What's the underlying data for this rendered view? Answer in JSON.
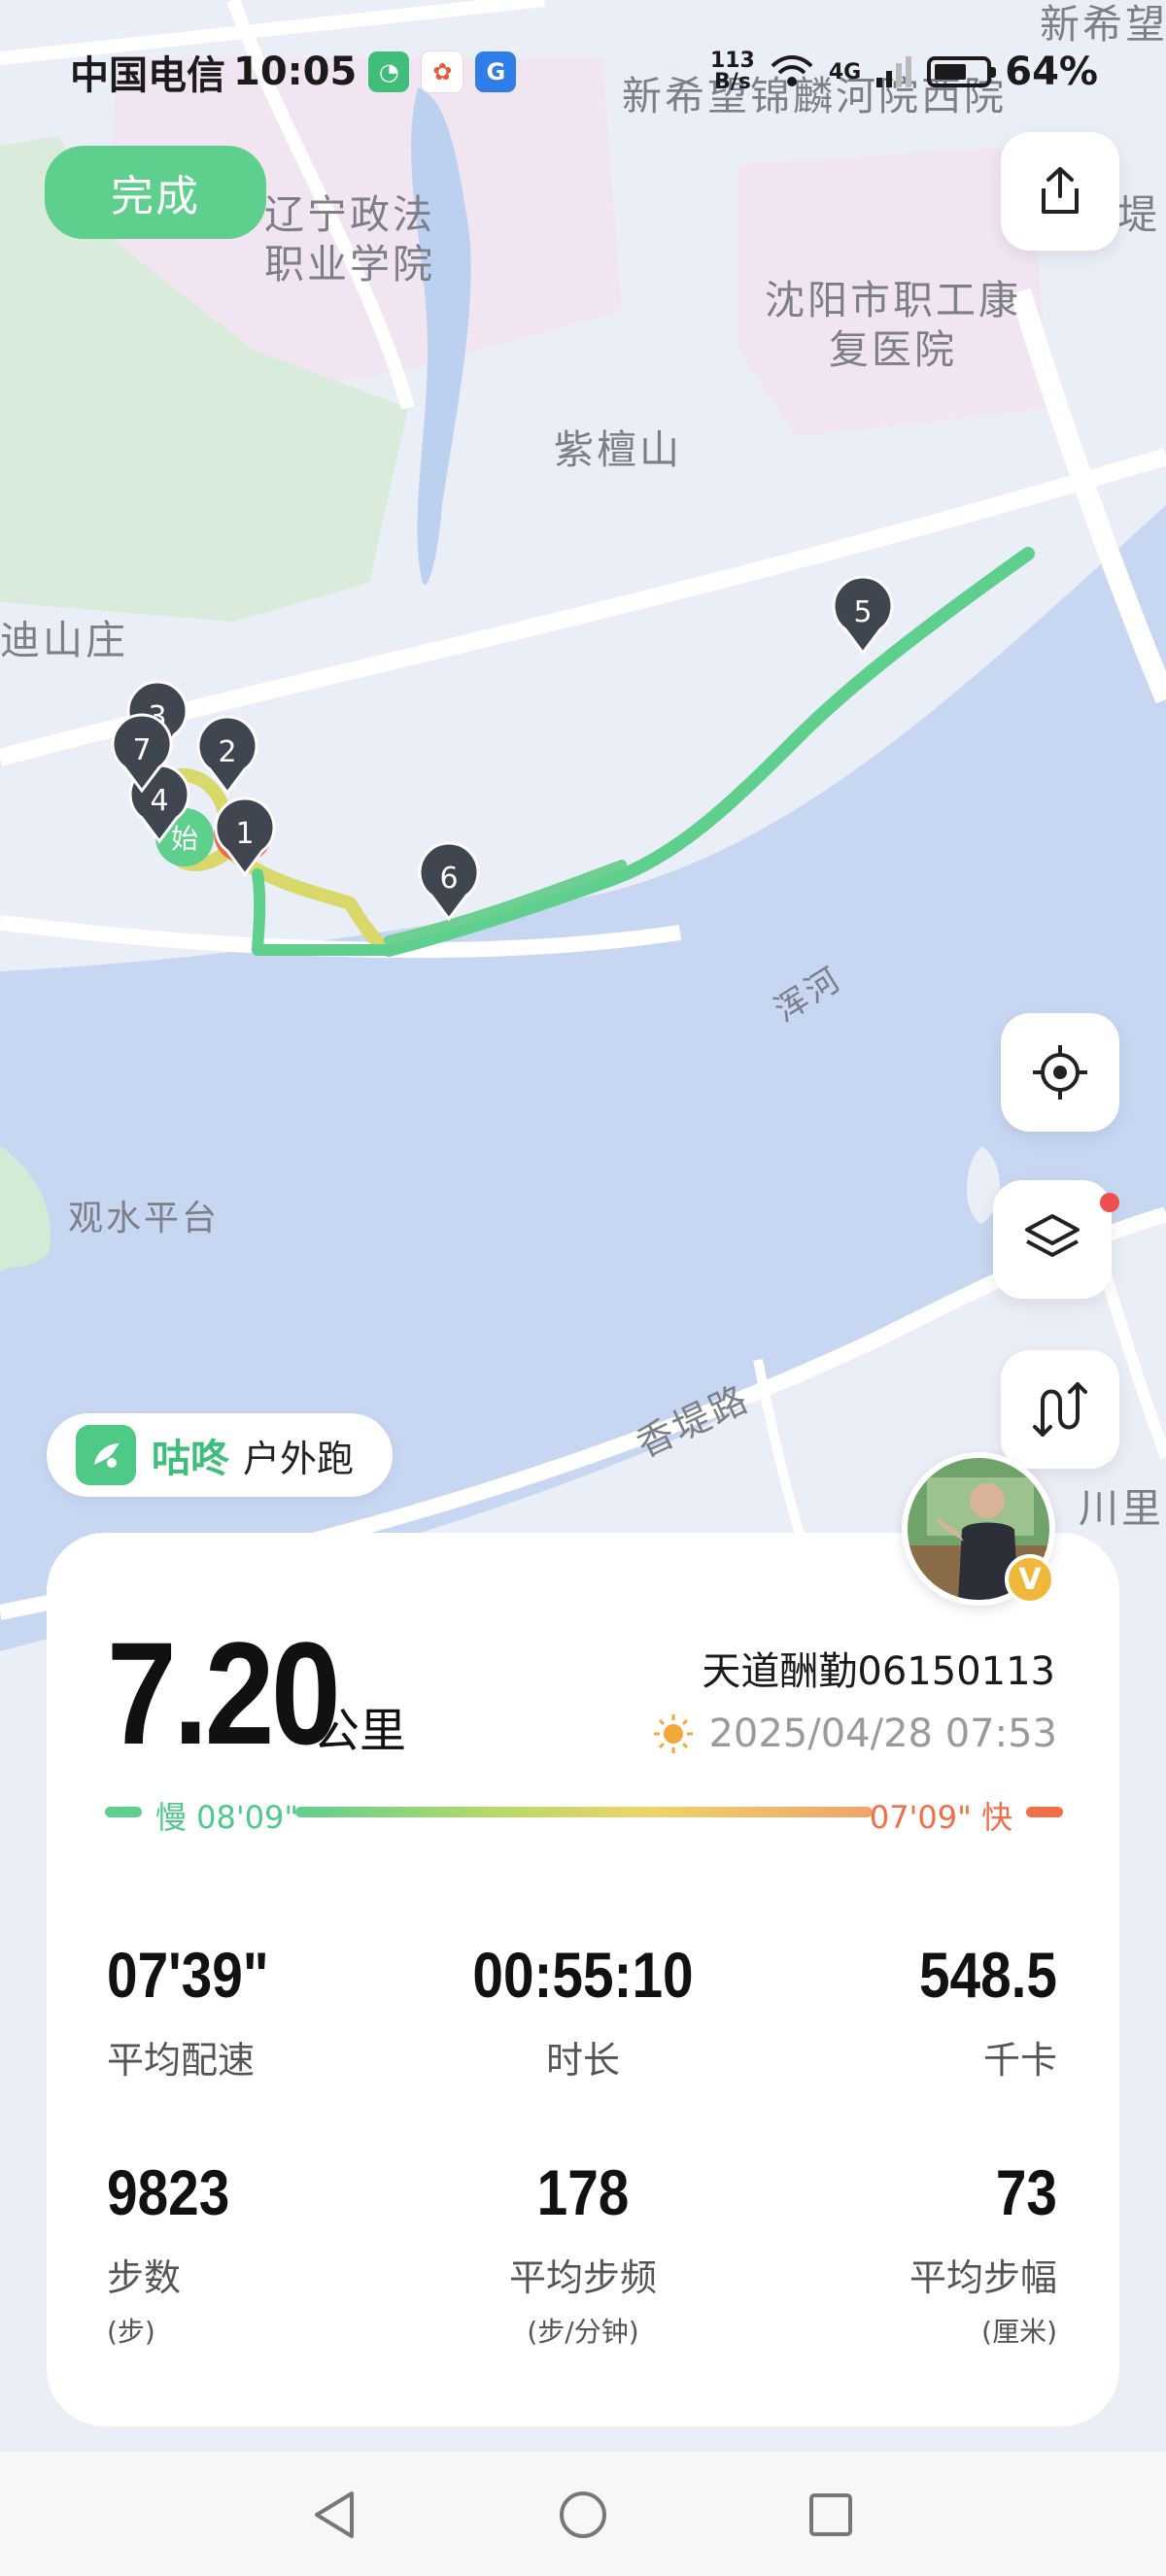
{
  "status_bar": {
    "carrier": "中国电信",
    "time": "10:05",
    "net_speed": "113",
    "net_unit": "B/s",
    "network": "4G",
    "battery_percent": "64%",
    "battery_level": 0.64
  },
  "map": {
    "labels": [
      "新希望锦麟河院西院",
      "辽宁政法职业学院",
      "沈阳市职工康复医院",
      "紫檀山",
      "迪山庄",
      "浑河",
      "观水平台",
      "香堤路",
      "新希望",
      "川里",
      "堤"
    ],
    "route_markers": [
      "1",
      "2",
      "3",
      "4",
      "5",
      "6",
      "7"
    ]
  },
  "toolbar": {
    "done_label": "完成",
    "share_icon": "share-icon",
    "locate_icon": "locate-icon",
    "layers_icon": "layers-icon",
    "route_icon": "route-icon"
  },
  "brand": {
    "name": "咕咚",
    "activity": "户外跑"
  },
  "summary": {
    "distance": "7.20",
    "distance_unit": "公里",
    "username": "天道酬勤06150113",
    "datetime": "2025/04/28 07:53",
    "weather_icon": "sun-icon",
    "pace_slow_label": "慢 08'09\"",
    "pace_fast_label": "07'09\" 快"
  },
  "stats": [
    {
      "value": "07'39\"",
      "label": "平均配速",
      "unit": ""
    },
    {
      "value": "00:55:10",
      "label": "时长",
      "unit": ""
    },
    {
      "value": "548.5",
      "label": "千卡",
      "unit": ""
    },
    {
      "value": "9823",
      "label": "步数",
      "unit": "(步)"
    },
    {
      "value": "178",
      "label": "平均步频",
      "unit": "(步/分钟)"
    },
    {
      "value": "73",
      "label": "平均步幅",
      "unit": "(厘米)"
    }
  ],
  "colors": {
    "accent_green": "#5fcf8e",
    "route_yellow": "#d9d86a",
    "water": "#c7d7f2",
    "marker": "#3f4650",
    "fast_red": "#ee6f48"
  }
}
